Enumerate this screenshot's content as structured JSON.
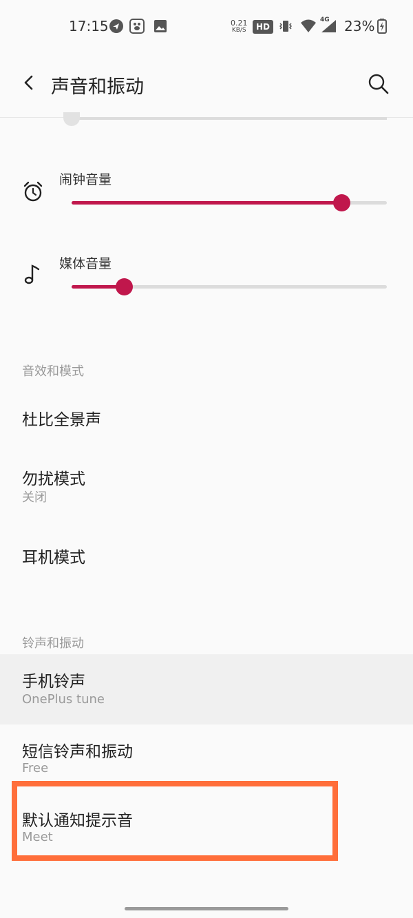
{
  "status_bar": {
    "time": "17:15",
    "net_speed_value": "0.21",
    "net_speed_unit": "KB/S",
    "hd_label": "HD",
    "network_type": "4G",
    "battery": "23%"
  },
  "header": {
    "title": "声音和振动"
  },
  "volumes": {
    "alarm": {
      "label": "闹钟音量",
      "level": 0.855
    },
    "media": {
      "label": "媒体音量",
      "level": 0.165
    }
  },
  "sections": {
    "effects": {
      "header": "音效和模式",
      "items": [
        {
          "title": "杜比全景声",
          "subtitle": ""
        },
        {
          "title": "勿扰模式",
          "subtitle": "关闭"
        },
        {
          "title": "耳机模式",
          "subtitle": ""
        }
      ]
    },
    "ringtones": {
      "header": "铃声和振动",
      "items": [
        {
          "title": "手机铃声",
          "subtitle": "OnePlus tune"
        },
        {
          "title": "短信铃声和振动",
          "subtitle": "Free"
        },
        {
          "title": "默认通知提示音",
          "subtitle": "Meet"
        }
      ]
    }
  },
  "colors": {
    "accent": "#c0174c",
    "annotation": "#ff6e3a"
  }
}
